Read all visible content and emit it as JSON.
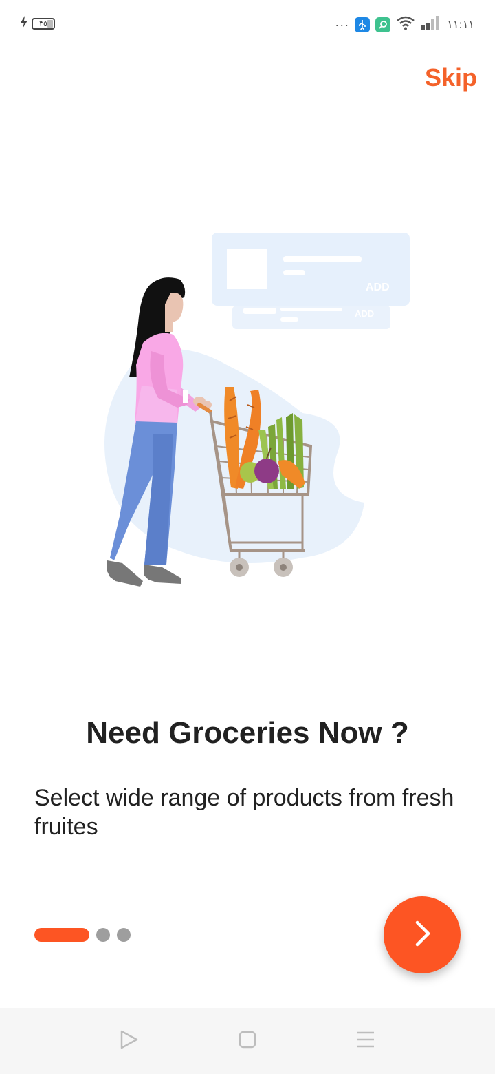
{
  "status_bar": {
    "battery_level": "٣٥",
    "time": "١١:١١",
    "overflow": "···",
    "icons": [
      "charging-icon",
      "usb-icon",
      "app-notification-icon",
      "wifi-icon",
      "signal-icon"
    ]
  },
  "onboarding": {
    "skip_label": "Skip",
    "illustration": {
      "name": "woman-shopping-cart-illustration",
      "card_label_1": "ADD",
      "card_label_2": "ADD"
    },
    "title": "Need Groceries Now ?",
    "description": "Select wide range of products from fresh fruites",
    "page_indicator": {
      "current_page": 1,
      "total_pages": 3
    },
    "next_icon": "chevron-right-icon"
  },
  "nav_bar": {
    "icons": [
      "back-triangle-icon",
      "home-square-icon",
      "menu-lines-icon"
    ]
  },
  "colors": {
    "accent": "#fd5523",
    "skip_text": "#f4622a",
    "inactive_dot": "#9e9e9e",
    "text": "#212121",
    "nav_background": "#f6f6f6"
  }
}
